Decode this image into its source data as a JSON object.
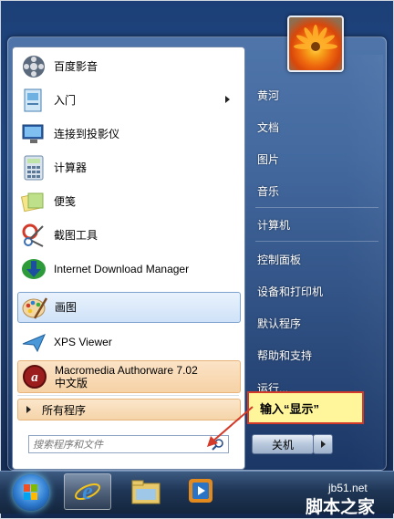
{
  "start_menu": {
    "pinned_items": [
      {
        "label": "百度影音",
        "icon": "baidu-player-icon"
      },
      {
        "label": "入门",
        "icon": "getting-started-icon",
        "has_submenu": true
      },
      {
        "label": "连接到投影仪",
        "icon": "projector-icon"
      },
      {
        "label": "计算器",
        "icon": "calculator-icon"
      },
      {
        "label": "便笺",
        "icon": "sticky-notes-icon"
      },
      {
        "label": "截图工具",
        "icon": "snipping-tool-icon"
      },
      {
        "label": "Internet Download Manager",
        "icon": "idm-icon"
      },
      {
        "label": "画图",
        "icon": "paint-icon",
        "highlighted": true
      },
      {
        "label": "XPS Viewer",
        "icon": "xps-viewer-icon"
      },
      {
        "label": "Macromedia Authorware 7.02",
        "label_line2": "中文版",
        "icon": "authorware-icon",
        "highlighted": true
      }
    ],
    "all_programs_label": "所有程序",
    "search": {
      "placeholder": "搜索程序和文件"
    },
    "right_items": [
      {
        "label": "黄河"
      },
      {
        "label": "文档"
      },
      {
        "label": "图片"
      },
      {
        "label": "音乐"
      },
      {
        "label": "计算机"
      },
      {
        "label": "控制面板"
      },
      {
        "label": "设备和打印机"
      },
      {
        "label": "默认程序"
      },
      {
        "label": "帮助和支持"
      },
      {
        "label": "运行..."
      }
    ],
    "shutdown_label": "关机"
  },
  "callout": {
    "text": "输入“显示”"
  },
  "taskbar": {
    "buttons": [
      {
        "name": "start-orb"
      },
      {
        "name": "internet-explorer-icon"
      },
      {
        "name": "file-explorer-icon"
      },
      {
        "name": "media-player-icon"
      }
    ]
  },
  "watermark": {
    "site": "jb51.net",
    "name": "脚本之家"
  },
  "colors": {
    "accent_red": "#d23a2a",
    "callout_bg": "#fff59a",
    "highlight_blue": "#cfe2f8",
    "highlight_orange": "#f6d2a6"
  }
}
